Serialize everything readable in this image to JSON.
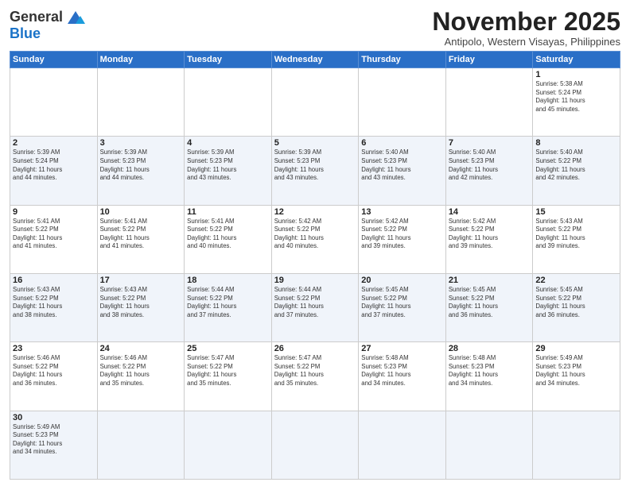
{
  "header": {
    "logo_general": "General",
    "logo_blue": "Blue",
    "month_title": "November 2025",
    "subtitle": "Antipolo, Western Visayas, Philippines"
  },
  "days_of_week": [
    "Sunday",
    "Monday",
    "Tuesday",
    "Wednesday",
    "Thursday",
    "Friday",
    "Saturday"
  ],
  "weeks": [
    [
      {
        "day": "",
        "info": ""
      },
      {
        "day": "",
        "info": ""
      },
      {
        "day": "",
        "info": ""
      },
      {
        "day": "",
        "info": ""
      },
      {
        "day": "",
        "info": ""
      },
      {
        "day": "",
        "info": ""
      },
      {
        "day": "1",
        "info": "Sunrise: 5:38 AM\nSunset: 5:24 PM\nDaylight: 11 hours\nand 45 minutes."
      }
    ],
    [
      {
        "day": "2",
        "info": "Sunrise: 5:39 AM\nSunset: 5:24 PM\nDaylight: 11 hours\nand 44 minutes."
      },
      {
        "day": "3",
        "info": "Sunrise: 5:39 AM\nSunset: 5:23 PM\nDaylight: 11 hours\nand 44 minutes."
      },
      {
        "day": "4",
        "info": "Sunrise: 5:39 AM\nSunset: 5:23 PM\nDaylight: 11 hours\nand 43 minutes."
      },
      {
        "day": "5",
        "info": "Sunrise: 5:39 AM\nSunset: 5:23 PM\nDaylight: 11 hours\nand 43 minutes."
      },
      {
        "day": "6",
        "info": "Sunrise: 5:40 AM\nSunset: 5:23 PM\nDaylight: 11 hours\nand 43 minutes."
      },
      {
        "day": "7",
        "info": "Sunrise: 5:40 AM\nSunset: 5:23 PM\nDaylight: 11 hours\nand 42 minutes."
      },
      {
        "day": "8",
        "info": "Sunrise: 5:40 AM\nSunset: 5:22 PM\nDaylight: 11 hours\nand 42 minutes."
      }
    ],
    [
      {
        "day": "9",
        "info": "Sunrise: 5:41 AM\nSunset: 5:22 PM\nDaylight: 11 hours\nand 41 minutes."
      },
      {
        "day": "10",
        "info": "Sunrise: 5:41 AM\nSunset: 5:22 PM\nDaylight: 11 hours\nand 41 minutes."
      },
      {
        "day": "11",
        "info": "Sunrise: 5:41 AM\nSunset: 5:22 PM\nDaylight: 11 hours\nand 40 minutes."
      },
      {
        "day": "12",
        "info": "Sunrise: 5:42 AM\nSunset: 5:22 PM\nDaylight: 11 hours\nand 40 minutes."
      },
      {
        "day": "13",
        "info": "Sunrise: 5:42 AM\nSunset: 5:22 PM\nDaylight: 11 hours\nand 39 minutes."
      },
      {
        "day": "14",
        "info": "Sunrise: 5:42 AM\nSunset: 5:22 PM\nDaylight: 11 hours\nand 39 minutes."
      },
      {
        "day": "15",
        "info": "Sunrise: 5:43 AM\nSunset: 5:22 PM\nDaylight: 11 hours\nand 39 minutes."
      }
    ],
    [
      {
        "day": "16",
        "info": "Sunrise: 5:43 AM\nSunset: 5:22 PM\nDaylight: 11 hours\nand 38 minutes."
      },
      {
        "day": "17",
        "info": "Sunrise: 5:43 AM\nSunset: 5:22 PM\nDaylight: 11 hours\nand 38 minutes."
      },
      {
        "day": "18",
        "info": "Sunrise: 5:44 AM\nSunset: 5:22 PM\nDaylight: 11 hours\nand 37 minutes."
      },
      {
        "day": "19",
        "info": "Sunrise: 5:44 AM\nSunset: 5:22 PM\nDaylight: 11 hours\nand 37 minutes."
      },
      {
        "day": "20",
        "info": "Sunrise: 5:45 AM\nSunset: 5:22 PM\nDaylight: 11 hours\nand 37 minutes."
      },
      {
        "day": "21",
        "info": "Sunrise: 5:45 AM\nSunset: 5:22 PM\nDaylight: 11 hours\nand 36 minutes."
      },
      {
        "day": "22",
        "info": "Sunrise: 5:45 AM\nSunset: 5:22 PM\nDaylight: 11 hours\nand 36 minutes."
      }
    ],
    [
      {
        "day": "23",
        "info": "Sunrise: 5:46 AM\nSunset: 5:22 PM\nDaylight: 11 hours\nand 36 minutes."
      },
      {
        "day": "24",
        "info": "Sunrise: 5:46 AM\nSunset: 5:22 PM\nDaylight: 11 hours\nand 35 minutes."
      },
      {
        "day": "25",
        "info": "Sunrise: 5:47 AM\nSunset: 5:22 PM\nDaylight: 11 hours\nand 35 minutes."
      },
      {
        "day": "26",
        "info": "Sunrise: 5:47 AM\nSunset: 5:22 PM\nDaylight: 11 hours\nand 35 minutes."
      },
      {
        "day": "27",
        "info": "Sunrise: 5:48 AM\nSunset: 5:23 PM\nDaylight: 11 hours\nand 34 minutes."
      },
      {
        "day": "28",
        "info": "Sunrise: 5:48 AM\nSunset: 5:23 PM\nDaylight: 11 hours\nand 34 minutes."
      },
      {
        "day": "29",
        "info": "Sunrise: 5:49 AM\nSunset: 5:23 PM\nDaylight: 11 hours\nand 34 minutes."
      }
    ],
    [
      {
        "day": "30",
        "info": "Sunrise: 5:49 AM\nSunset: 5:23 PM\nDaylight: 11 hours\nand 34 minutes."
      },
      {
        "day": "",
        "info": ""
      },
      {
        "day": "",
        "info": ""
      },
      {
        "day": "",
        "info": ""
      },
      {
        "day": "",
        "info": ""
      },
      {
        "day": "",
        "info": ""
      },
      {
        "day": "",
        "info": ""
      }
    ]
  ]
}
